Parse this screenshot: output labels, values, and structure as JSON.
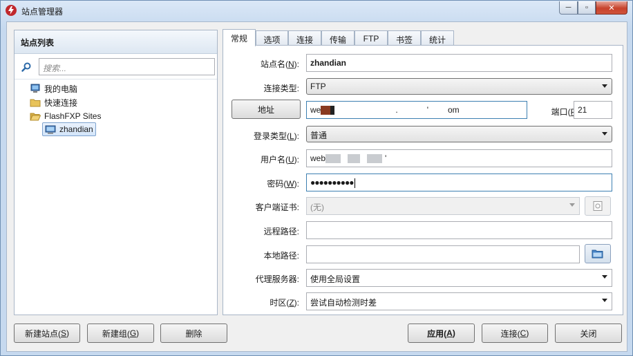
{
  "window": {
    "title": "站点管理器",
    "min": "─",
    "max": "▫",
    "close": "✕"
  },
  "left_panel": {
    "header": "站点列表",
    "search_placeholder": "搜索...",
    "tree": {
      "my_computer": "我的电脑",
      "quick_connect": "快速连接",
      "sites_folder": "FlashFXP Sites",
      "site": "zhandian"
    }
  },
  "tabs": [
    "常规",
    "选项",
    "连接",
    "传输",
    "FTP",
    "书签",
    "统计"
  ],
  "form": {
    "site_name_label": "站点名(",
    "site_name_key": "N",
    "site_name_value": "zhandian",
    "conn_type_label": "连接类型:",
    "conn_type_value": "FTP",
    "address_button": "地址",
    "address_prefix": "we",
    "address_dot": ".",
    "address_mark": "'",
    "address_suffix": "om",
    "port_label": "端口(",
    "port_key": "P",
    "port_value": "21",
    "login_type_label": "登录类型(",
    "login_type_key": "L",
    "login_type_value": "普通",
    "username_label": "用户名(",
    "username_key": "U",
    "username_prefix": "web",
    "username_suffix": "'",
    "password_label": "密码(",
    "password_key": "W",
    "password_value": "●●●●●●●●●●",
    "client_cert_label": "客户端证书:",
    "client_cert_value": "(无)",
    "remote_path_label": "远程路径:",
    "remote_path_value": "",
    "local_path_label": "本地路径:",
    "local_path_value": "",
    "proxy_label": "代理服务器:",
    "proxy_value": "使用全局设置",
    "timezone_label": "时区(",
    "timezone_key": "Z",
    "timezone_value": "尝试自动检测时差"
  },
  "buttons": {
    "new_site": "新建站点(",
    "new_site_key": "S",
    "new_group": "新建组(",
    "new_group_key": "G",
    "delete": "删除",
    "apply": "应用(",
    "apply_key": "A",
    "connect": "连接(",
    "connect_key": "C",
    "close": "关闭"
  },
  "colors": {
    "accent": "#3c7fb1",
    "window_frame": "#c6d9ef",
    "close_button": "#c7432c"
  }
}
